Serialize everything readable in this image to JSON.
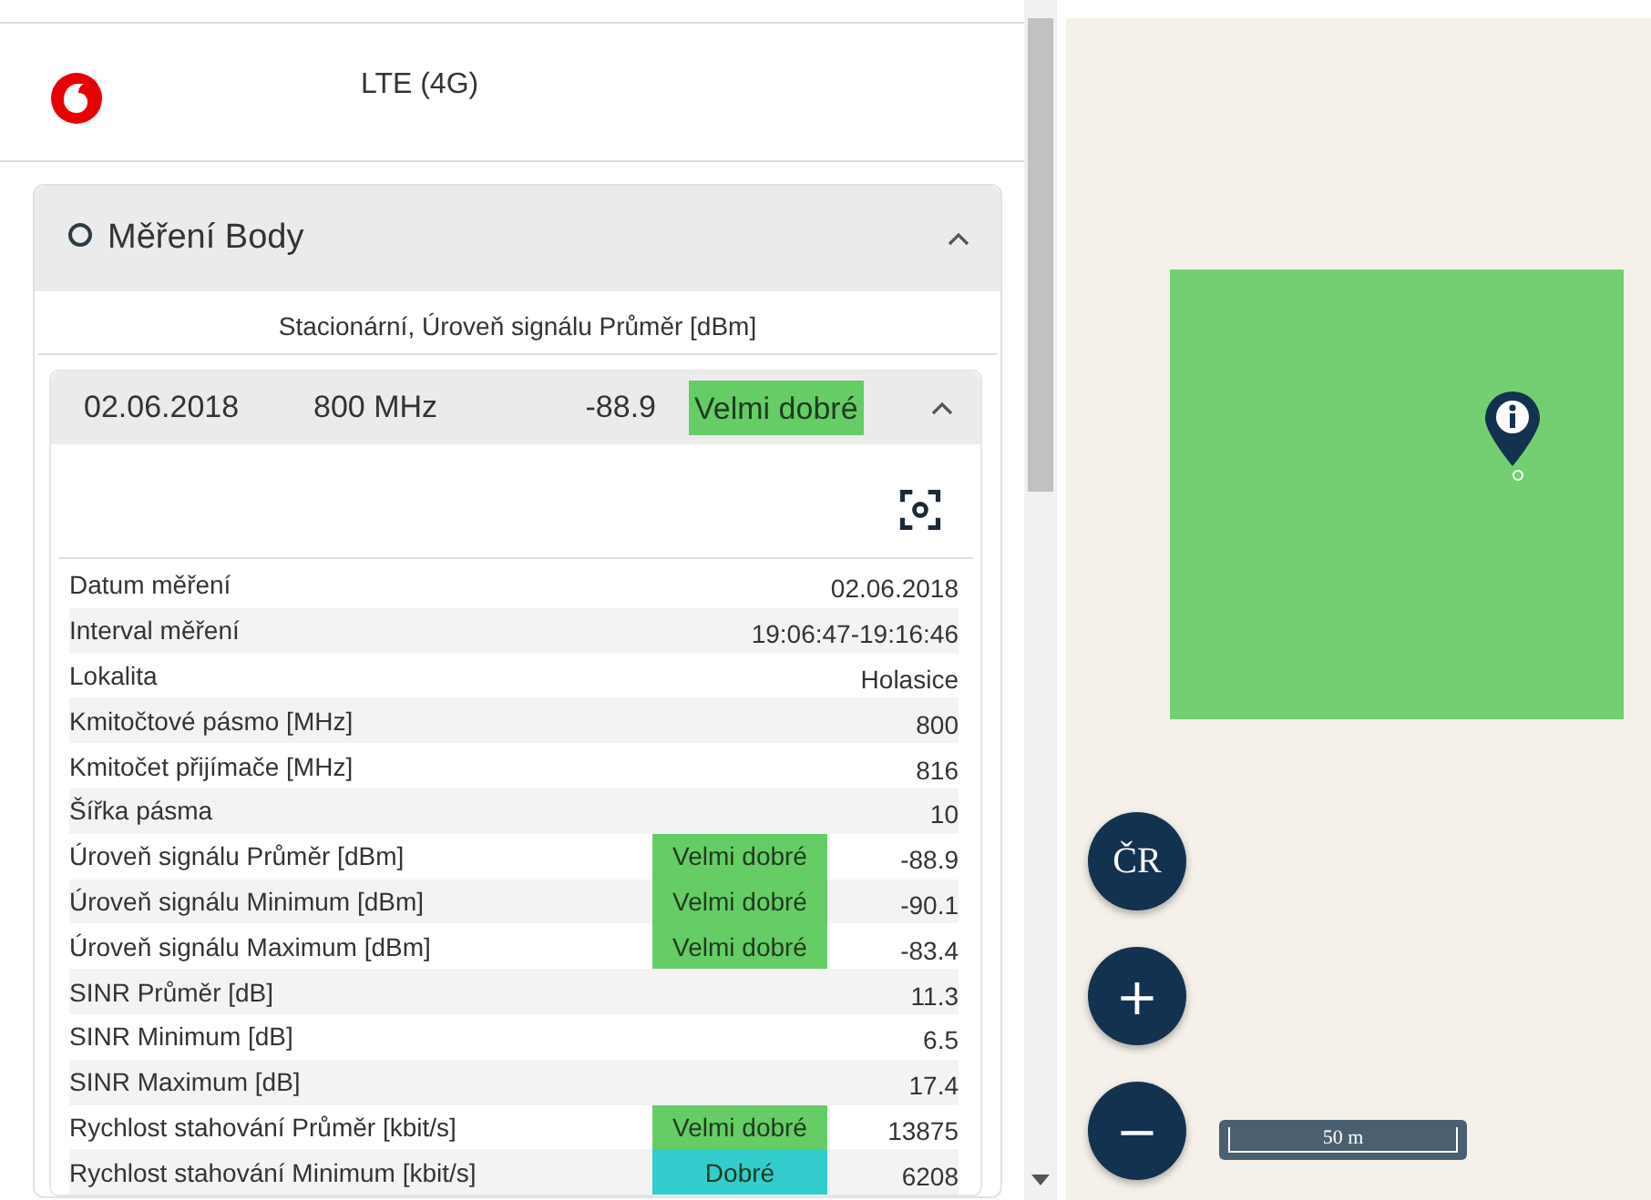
{
  "operator": {
    "network": "LTE (4G)"
  },
  "section": {
    "title": "Měření Body",
    "expanded": true,
    "subtitle": "Stacionární, Úroveň signálu Průměr [dBm]",
    "measurement": {
      "date": "02.06.2018",
      "band": "800 MHz",
      "value": "-88.9",
      "rating": "Velmi dobré",
      "color": "#66cc66",
      "expanded": true
    },
    "rows": [
      {
        "label": "Datum měření",
        "value": "02.06.2018"
      },
      {
        "label": "Interval měření",
        "value": "19:06:47-19:16:46"
      },
      {
        "label": "Lokalita",
        "value": "Holasice"
      },
      {
        "label": "Kmitočtové pásmo [MHz]",
        "value": "800"
      },
      {
        "label": "Kmitočet přijímače [MHz]",
        "value": "816"
      },
      {
        "label": "Šířka pásma",
        "value": "10"
      },
      {
        "label": "Úroveň signálu Průměr [dBm]",
        "rating": "Velmi dobré",
        "color": "#66cc66",
        "value": "-88.9"
      },
      {
        "label": "Úroveň signálu Minimum [dBm]",
        "rating": "Velmi dobré",
        "color": "#66cc66",
        "value": "-90.1"
      },
      {
        "label": "Úroveň signálu Maximum [dBm]",
        "rating": "Velmi dobré",
        "color": "#66cc66",
        "value": "-83.4"
      },
      {
        "label": "SINR Průměr [dB]",
        "value": "11.3"
      },
      {
        "label": "SINR Minimum [dB]",
        "value": "6.5"
      },
      {
        "label": "SINR Maximum [dB]",
        "value": "17.4"
      },
      {
        "label": "Rychlost stahování Průměr [kbit/s]",
        "rating": "Velmi dobré",
        "color": "#66cc66",
        "value": "13875"
      },
      {
        "label": "Rychlost stahování Minimum [kbit/s]",
        "rating": "Dobré",
        "color": "#33cccc",
        "value": "6208"
      }
    ]
  },
  "map": {
    "buttons": [
      "ČR",
      "+",
      "−"
    ],
    "scale": "50 m"
  }
}
